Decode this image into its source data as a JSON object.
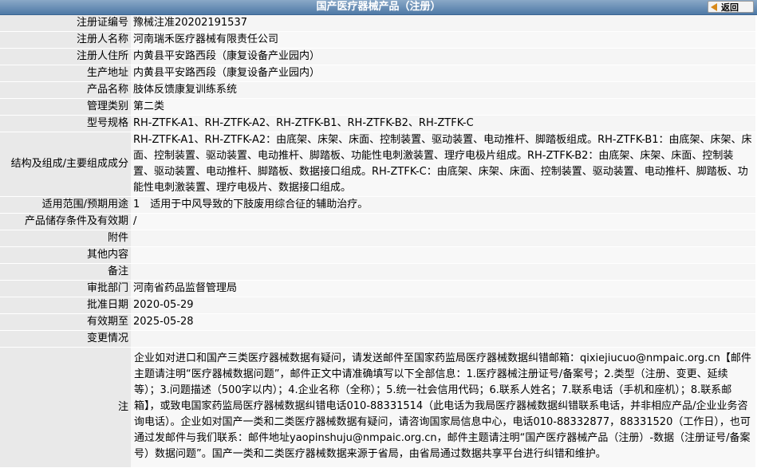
{
  "header": {
    "title": "国产医疗器械产品（注册）",
    "back_label": "返回"
  },
  "rows": [
    {
      "label": "注册证编号",
      "value": "豫械注准20202191537"
    },
    {
      "label": "注册人名称",
      "value": "河南瑞禾医疗器械有限责任公司"
    },
    {
      "label": "注册人住所",
      "value": "内黄县平安路西段（康复设备产业园内）"
    },
    {
      "label": "生产地址",
      "value": "内黄县平安路西段（康复设备产业园内）"
    },
    {
      "label": "产品名称",
      "value": "肢体反馈康复训练系统"
    },
    {
      "label": "管理类别",
      "value": "第二类"
    },
    {
      "label": "型号规格",
      "value": "RH-ZTFK-A1、RH-ZTFK-A2、RH-ZTFK-B1、RH-ZTFK-B2、RH-ZTFK-C"
    },
    {
      "label": "结构及组成/主要组成成分",
      "value": "RH-ZTFK-A1、RH-ZTFK-A2：由底架、床架、床面、控制装置、驱动装置、电动推杆、脚踏板组成。RH-ZTFK-B1：由底架、床架、床面、控制装置、驱动装置、电动推杆、脚踏板、功能性电刺激装置、理疗电极片组成。RH-ZTFK-B2：由底架、床架、床面、控制装置、驱动装置、电动推杆、脚踏板、数据接口组成。RH-ZTFK-C：由底架、床架、床面、控制装置、驱动装置、电动推杆、脚踏板、功能性电刺激装置、理疗电极片、数据接口组成。"
    },
    {
      "label": "适用范围/预期用途",
      "value": "1　适用于中风导致的下肢废用综合征的辅助治疗。"
    },
    {
      "label": "产品储存条件及有效期",
      "value": "/"
    },
    {
      "label": "附件",
      "value": ""
    },
    {
      "label": "其他内容",
      "value": ""
    },
    {
      "label": "备注",
      "value": ""
    },
    {
      "label": "审批部门",
      "value": "河南省药品监督管理局"
    },
    {
      "label": "批准日期",
      "value": "2020-05-29"
    },
    {
      "label": "有效期至",
      "value": "2025-05-28"
    },
    {
      "label": "变更情况",
      "value": ""
    }
  ],
  "note": {
    "label": "注",
    "text": "企业如对进口和国产三类医疗器械数据有疑问，请发送邮件至国家药监局医疗器械数据纠错邮箱：qixiejiucuo@nmpaic.org.cn【邮件主题请注明“医疗器械数据问题”，邮件正文中请准确填写以下全部信息：1.医疗器械注册证号/备案号；2.类型（注册、变更、延续等）；3.问题描述（500字以内）；4.企业名称（全称）；5.统一社会信用代码；6.联系人姓名；7.联系电话（手机和座机）；8.联系邮箱】，或致电国家药监局医疗器械数据纠错电话010-88331514（此电话为我局医疗器械数据纠错联系电话，并非相应产品/企业业务咨询电话）。企业如对国产一类和二类医疗器械数据有疑问，请咨询国家局信息中心，电话010-88332877，88331520（工作日），也可通过发邮件与我们联系：邮件地址yaopinshuju@nmpaic.org.cn，邮件主题请注明“国产医疗器械产品（注册）-数据（注册证号/备案号）数据问题”。国产一类和二类医疗器械数据来源于省局，由省局通过数据共享平台进行纠错和维护。"
  }
}
